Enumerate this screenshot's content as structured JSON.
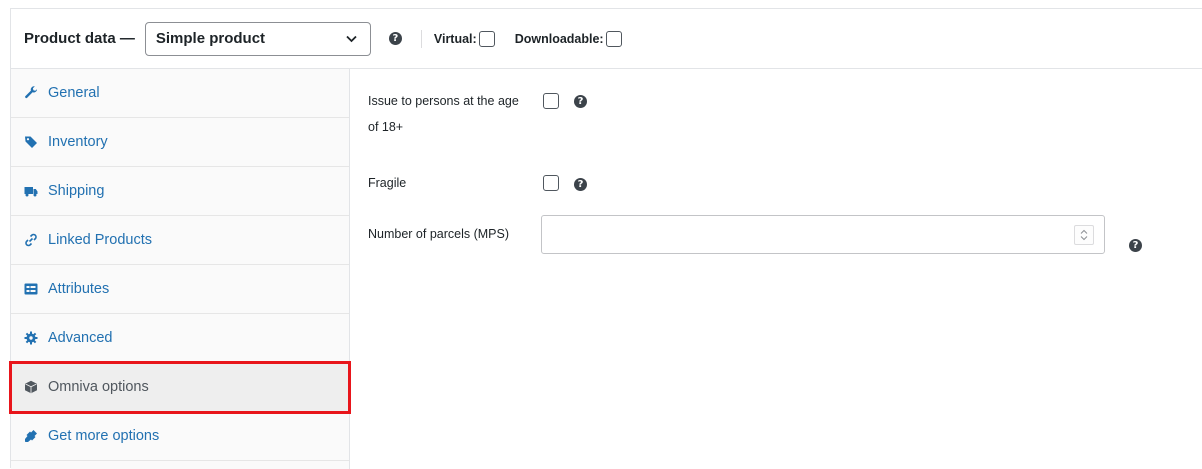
{
  "header": {
    "title": "Product data —",
    "product_type": "Simple product",
    "virtual_label": "Virtual:",
    "downloadable_label": "Downloadable:",
    "help_glyph": "?"
  },
  "tabs": [
    {
      "label": "General",
      "icon": "wrench-icon"
    },
    {
      "label": "Inventory",
      "icon": "tag-icon"
    },
    {
      "label": "Shipping",
      "icon": "truck-icon"
    },
    {
      "label": "Linked Products",
      "icon": "link-icon"
    },
    {
      "label": "Attributes",
      "icon": "attributes-icon"
    },
    {
      "label": "Advanced",
      "icon": "gear-icon"
    },
    {
      "label": "Omniva options",
      "icon": "box-icon",
      "active": true
    },
    {
      "label": "Get more options",
      "icon": "plugin-icon"
    }
  ],
  "fields": {
    "age_label_line1": "Issue to persons at the age",
    "age_label_line2": "of 18+",
    "fragile_label": "Fragile",
    "parcels_label": "Number of parcels (MPS)",
    "parcels_value": ""
  },
  "colors": {
    "link": "#2271b1",
    "highlight": "#e8151b",
    "help_bg": "#3c434a"
  }
}
